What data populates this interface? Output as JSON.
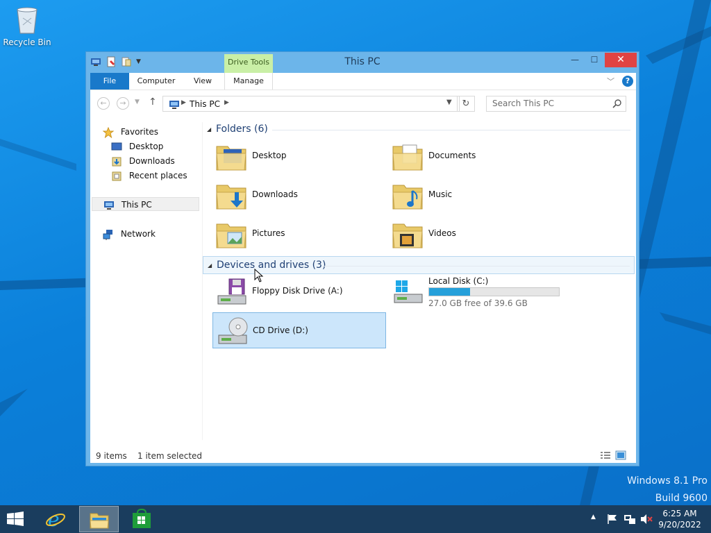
{
  "desktop": {
    "recycle_bin_label": "Recycle Bin",
    "watermark_line1": "Windows 8.1 Pro",
    "watermark_line2": "Build 9600"
  },
  "window": {
    "title": "This PC",
    "contextual_tab_group": "Drive Tools",
    "tabs": [
      {
        "label": "File",
        "active": true
      },
      {
        "label": "Computer"
      },
      {
        "label": "View"
      },
      {
        "label": "Manage"
      }
    ],
    "close_glyph": "✕",
    "minimize_glyph": "—",
    "maximize_glyph": "☐"
  },
  "navbar": {
    "address_path": "This PC",
    "search_placeholder": "Search This PC"
  },
  "nav_pane": {
    "favorites": "Favorites",
    "desktop": "Desktop",
    "downloads": "Downloads",
    "recent_places": "Recent places",
    "this_pc": "This PC",
    "network": "Network"
  },
  "main": {
    "folders_group": "Folders (6)",
    "devices_group": "Devices and drives (3)",
    "folders": [
      {
        "name": "Desktop",
        "icon": "desktop-folder-icon"
      },
      {
        "name": "Documents",
        "icon": "documents-folder-icon"
      },
      {
        "name": "Downloads",
        "icon": "downloads-folder-icon"
      },
      {
        "name": "Music",
        "icon": "music-folder-icon"
      },
      {
        "name": "Pictures",
        "icon": "pictures-folder-icon"
      },
      {
        "name": "Videos",
        "icon": "videos-folder-icon"
      }
    ],
    "drives": [
      {
        "name": "Floppy Disk Drive (A:)",
        "icon": "floppy-drive-icon"
      },
      {
        "name": "Local Disk (C:)",
        "icon": "local-disk-icon",
        "free_text": "27.0 GB free of 39.6 GB",
        "used_fraction": 0.318
      },
      {
        "name": "CD Drive (D:)",
        "icon": "cd-drive-icon",
        "selected": true
      }
    ]
  },
  "statusbar": {
    "items": "9 items",
    "selected": "1 item selected"
  },
  "taskbar": {
    "time": "6:25 AM",
    "date": "9/20/2022",
    "apps": [
      "internet-explorer",
      "file-explorer",
      "store"
    ]
  },
  "colors": {
    "accent": "#1979ca",
    "selection": "#cce6fb",
    "capacity_fill": "#26a0da",
    "close_button": "#e04343",
    "window_frame": "#6cb5ea"
  }
}
